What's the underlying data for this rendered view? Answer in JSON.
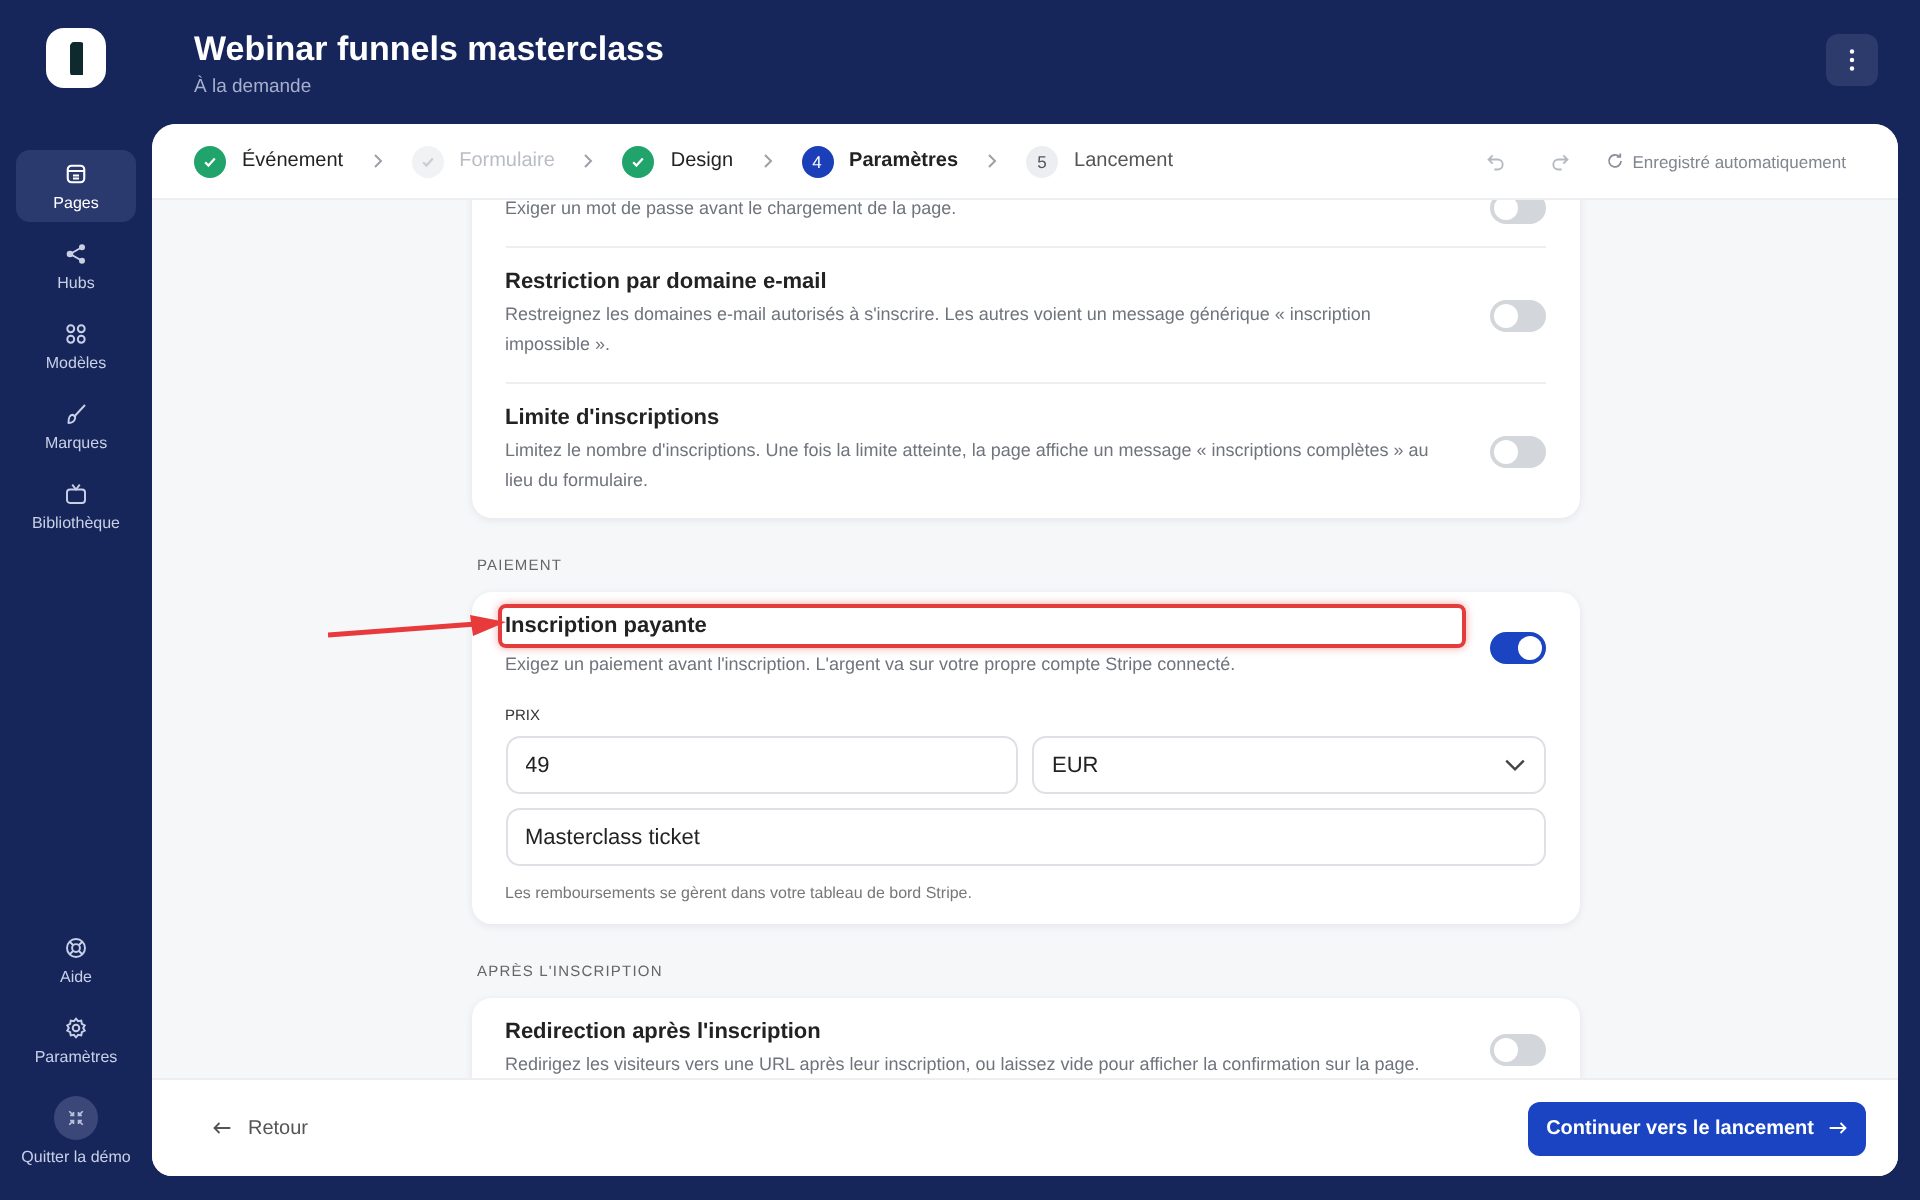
{
  "sidebar": {
    "items": [
      {
        "label": "Pages",
        "selected": true
      },
      {
        "label": "Hubs",
        "selected": false
      },
      {
        "label": "Modèles",
        "selected": false
      },
      {
        "label": "Marques",
        "selected": false
      },
      {
        "label": "Bibliothèque",
        "selected": false
      }
    ],
    "bottom_items": [
      {
        "label": "Aide"
      },
      {
        "label": "Paramètres"
      },
      {
        "label": "Quitter la démo"
      }
    ]
  },
  "header": {
    "title": "Webinar funnels masterclass",
    "subtitle": "À la demande"
  },
  "stepper": {
    "steps": [
      {
        "label": "Événement",
        "done": true,
        "disabled": false,
        "selected": false
      },
      {
        "label": "Formulaire",
        "done": true,
        "disabled": true,
        "selected": false
      },
      {
        "label": "Design",
        "done": true,
        "disabled": false,
        "selected": false
      },
      {
        "label": "Paramètres",
        "number": "4",
        "done": false,
        "disabled": false,
        "selected": true
      },
      {
        "label": "Lancement",
        "number": "5",
        "done": false,
        "disabled": false,
        "selected": false
      }
    ],
    "autosave": "Enregistré automatiquement"
  },
  "sections": [
    {
      "rows": [
        {
          "description": "Exiger un mot de passe avant le chargement de la page.",
          "on": false,
          "highlighted": false
        },
        {
          "title": "Restriction par domaine e-mail",
          "description": "Restreignez les domaines e-mail autorisés à s'inscrire. Les autres voient un message générique « inscription impossible ».",
          "on": false,
          "highlighted": false
        },
        {
          "title": "Limite d'inscriptions",
          "description": "Limitez le nombre d'inscriptions. Une fois la limite atteinte, la page affiche un message « inscriptions complètes » au lieu du formulaire.",
          "on": false,
          "highlighted": false
        }
      ]
    },
    {
      "heading": "PAIEMENT",
      "rows": [
        {
          "title": "Inscription payante",
          "description": "Exigez un paiement avant l'inscription. L'argent va sur votre propre compte Stripe connecté.",
          "on": true,
          "highlighted": true
        }
      ],
      "price": {
        "label": "PRIX",
        "amount": "49",
        "currency": "EUR",
        "product": "Masterclass ticket",
        "note": "Les remboursements se gèrent dans votre tableau de bord Stripe."
      }
    },
    {
      "heading": "APRÈS L'INSCRIPTION",
      "rows": [
        {
          "title": "Redirection après l'inscription",
          "description": "Redirigez les visiteurs vers une URL après leur inscription, ou laissez vide pour afficher la confirmation sur la page.",
          "on": false,
          "highlighted": false
        }
      ]
    }
  ],
  "footer": {
    "back": "Retour",
    "next": "Continuer vers le lancement"
  }
}
